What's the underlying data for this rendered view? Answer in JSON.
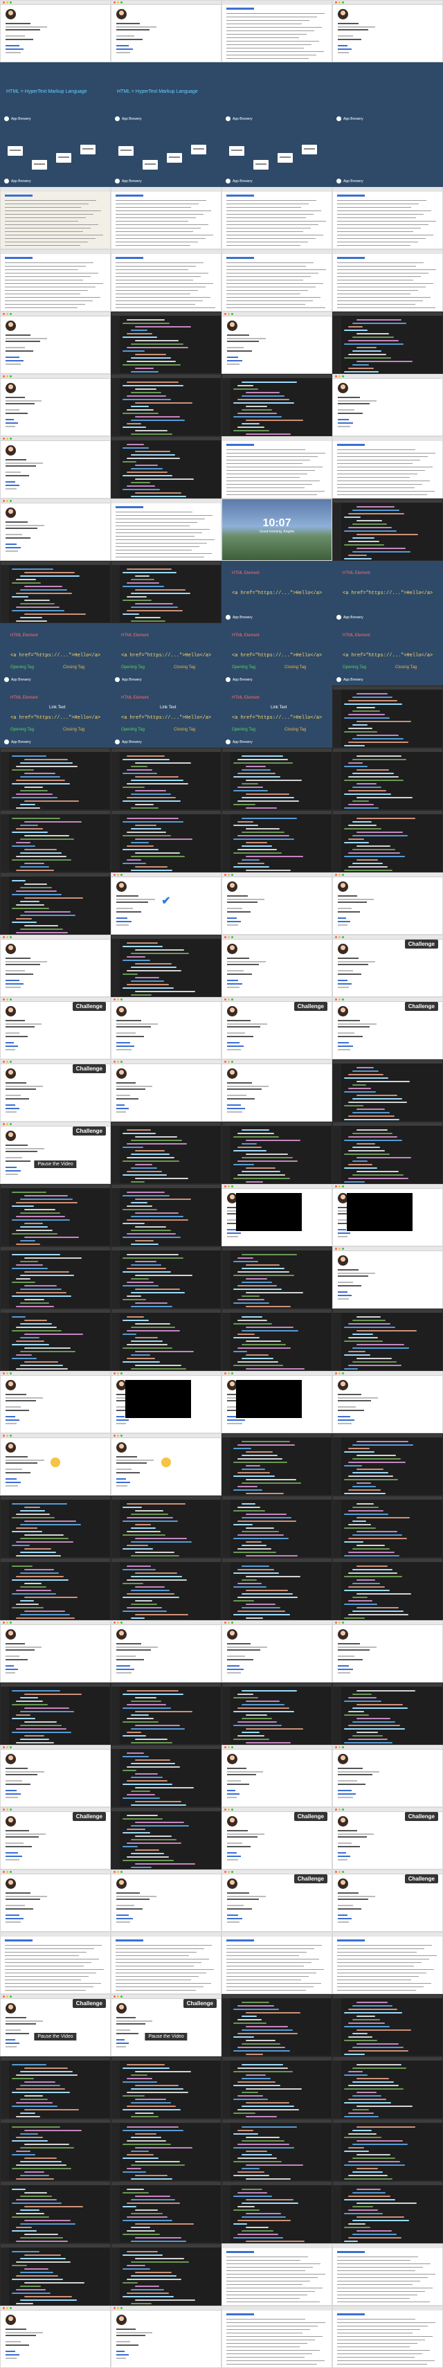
{
  "slides": {
    "html_title": "HTML = HyperText Markup Language",
    "brand": "App Brewery",
    "html_element": "HTML Element",
    "opening_tag": "Opening Tag",
    "closing_tag": "Closing Tag",
    "content": "Content",
    "attribute": "Attribute",
    "link_text": "Link Text",
    "code_example": "<a href=\"https://...\">Hello</a>"
  },
  "overlays": {
    "challenge": "Challenge",
    "pause": "Pause the Video"
  },
  "desktop": {
    "time": "10:07",
    "date": "Good morning, Angela"
  },
  "frames": [
    "profile",
    "profile",
    "doc",
    "profile",
    "navy",
    "navy",
    "navy",
    "navy",
    "navy-diagram",
    "navy-diagram",
    "navy-diagram",
    "navy",
    "beige",
    "doc",
    "doc",
    "doc",
    "doc",
    "doc",
    "doc",
    "doc",
    "profile",
    "editor",
    "profile",
    "editor",
    "profile",
    "editor",
    "editor",
    "profile",
    "profile",
    "editor",
    "doc",
    "doc",
    "profile",
    "doc",
    "scenic",
    "editor",
    "editor",
    "editor",
    "navy-code",
    "navy-code",
    "navy-tag",
    "navy-tag",
    "navy-tag",
    "navy-tag",
    "navy-link",
    "navy-link",
    "navy-link",
    "editor",
    "editor",
    "editor",
    "editor",
    "editor",
    "editor",
    "editor",
    "editor",
    "editor",
    "editor",
    "profile-check",
    "profile",
    "profile",
    "profile",
    "editor",
    "profile",
    "profile-challenge",
    "profile-challenge",
    "profile",
    "profile-challenge",
    "profile-challenge",
    "profile-challenge",
    "profile",
    "profile",
    "editor",
    "profile-pause",
    "editor",
    "editor",
    "editor",
    "editor",
    "editor",
    "video",
    "video",
    "editor",
    "editor",
    "editor",
    "profile",
    "editor",
    "editor",
    "editor",
    "editor",
    "profile",
    "video",
    "video",
    "profile",
    "profile-emoji",
    "profile-emoji",
    "editor",
    "editor",
    "editor",
    "editor",
    "editor",
    "editor",
    "editor",
    "editor",
    "editor",
    "editor",
    "profile",
    "profile",
    "profile",
    "profile",
    "editor",
    "editor",
    "editor",
    "editor",
    "profile",
    "editor",
    "profile",
    "profile",
    "profile-challenge",
    "editor",
    "profile-challenge",
    "profile-challenge",
    "profile",
    "profile",
    "profile-challenge",
    "profile-challenge",
    "doc",
    "doc",
    "doc",
    "doc",
    "profile-pause",
    "profile-pause",
    "editor",
    "editor",
    "editor",
    "editor",
    "editor",
    "editor",
    "editor",
    "editor",
    "editor",
    "editor",
    "editor",
    "editor",
    "editor",
    "editor",
    "editor",
    "editor",
    "doc",
    "doc",
    "profile",
    "profile",
    "doc",
    "doc"
  ]
}
